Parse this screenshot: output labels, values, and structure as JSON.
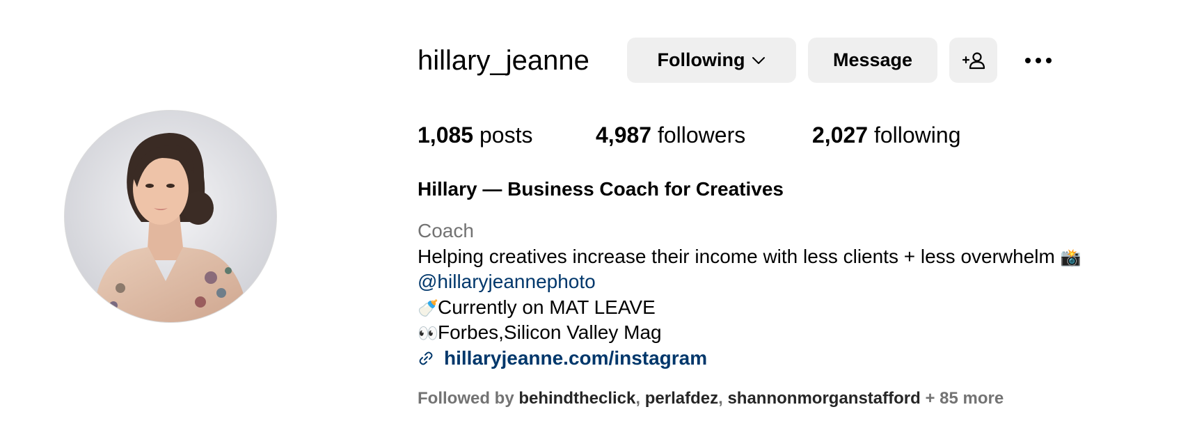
{
  "profile": {
    "username": "hillary_jeanne",
    "avatar_alt": "profile photo",
    "full_name": "Hillary — Business Coach for Creatives"
  },
  "actions": {
    "following_label": "Following",
    "message_label": "Message",
    "add_user_icon": "person-plus-icon",
    "more_icon": "more-options-icon"
  },
  "stats": {
    "posts_count": "1,085",
    "posts_label": " posts",
    "followers_count": "4,987",
    "followers_label": " followers",
    "following_count": "2,027",
    "following_label": " following"
  },
  "bio": {
    "category": "Coach",
    "line1": "Helping creatives increase their income with less clients + less overwhelm",
    "line1_emoji": "📸",
    "mention": "@hillaryjeannephoto",
    "line3_emoji": "🍼",
    "line3": "Currently on MAT LEAVE",
    "line4_emoji": "👀",
    "line4": "Forbes,Silicon Valley Mag",
    "link_icon": "link-icon",
    "link": "hillaryjeanne.com/instagram"
  },
  "followed_by": {
    "prefix": "Followed by ",
    "users": [
      "behindtheclick",
      "perlafdez",
      "shannonmorganstafford"
    ],
    "separator": ", ",
    "more": " + 85 more"
  },
  "colors": {
    "button_bg": "#efefef",
    "link": "#00376b",
    "secondary_text": "#737373"
  }
}
